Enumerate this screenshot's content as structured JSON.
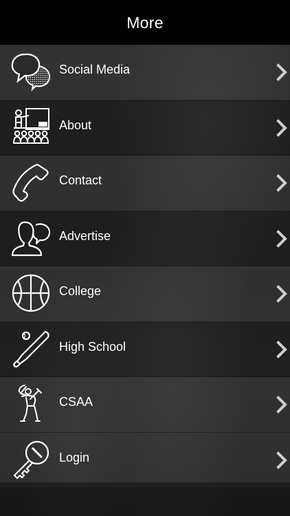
{
  "header": {
    "title": "More"
  },
  "menu": {
    "items": [
      {
        "label": "Social Media",
        "icon": "speech-bubbles-icon"
      },
      {
        "label": "About",
        "icon": "presentation-audience-icon"
      },
      {
        "label": "Contact",
        "icon": "phone-handset-icon"
      },
      {
        "label": "Advertise",
        "icon": "person-speaking-icon"
      },
      {
        "label": "College",
        "icon": "basketball-icon"
      },
      {
        "label": "High School",
        "icon": "baseball-bat-icon"
      },
      {
        "label": "CSAA",
        "icon": "golfer-icon"
      },
      {
        "label": "Login",
        "icon": "key-icon"
      }
    ],
    "chevron_icon": "chevron-right-icon"
  },
  "colors": {
    "header_bg": "#000000",
    "text": "#ffffff",
    "chevron": "#cfcfcf"
  }
}
